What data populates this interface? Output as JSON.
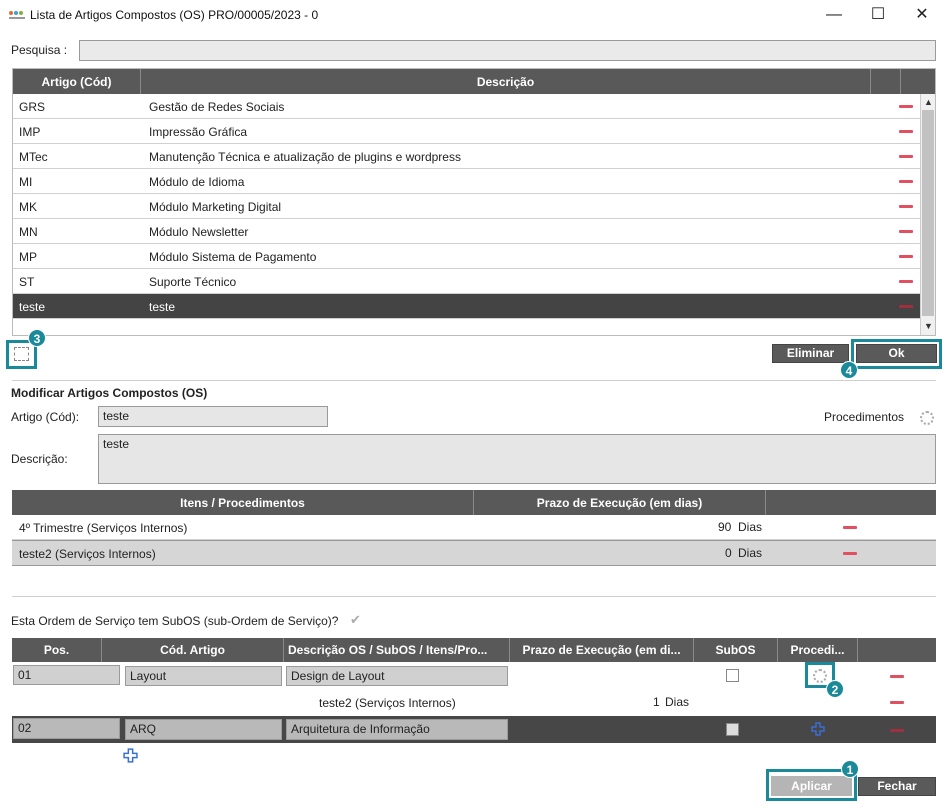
{
  "window": {
    "title": "Lista de Artigos Compostos (OS) PRO/00005/2023 - 0",
    "minimize": "—",
    "maximize": "☐",
    "close": "✕"
  },
  "search": {
    "label": "Pesquisa :",
    "value": ""
  },
  "articles_table": {
    "headers": [
      "Artigo (Cód)",
      "Descrição"
    ],
    "rows": [
      {
        "code": "GRS",
        "desc": "Gestão de Redes Sociais"
      },
      {
        "code": "IMP",
        "desc": "Impressão Gráfica"
      },
      {
        "code": "MTec",
        "desc": "Manutenção Técnica e atualização de plugins e wordpress"
      },
      {
        "code": "MI",
        "desc": "Módulo de Idioma"
      },
      {
        "code": "MK",
        "desc": "Módulo Marketing Digital"
      },
      {
        "code": "MN",
        "desc": "Módulo Newsletter"
      },
      {
        "code": "MP",
        "desc": "Módulo Sistema de Pagamento"
      },
      {
        "code": "ST",
        "desc": "Suporte Técnico"
      },
      {
        "code": "teste",
        "desc": "teste"
      }
    ],
    "selected_index": 8
  },
  "buttons": {
    "eliminar": "Eliminar",
    "ok": "Ok",
    "aplicar": "Aplicar",
    "fechar": "Fechar"
  },
  "callouts": [
    "1",
    "2",
    "3",
    "4"
  ],
  "modify": {
    "section_title": "Modificar Artigos Compostos (OS)",
    "code_label": "Artigo (Cód):",
    "code_value": "teste",
    "desc_label": "Descrição:",
    "desc_value": "teste",
    "procedimentos_label": "Procedimentos"
  },
  "items_table": {
    "headers": [
      "Itens / Procedimentos",
      "Prazo de Execução (em dias)"
    ],
    "rows": [
      {
        "item": "4º Trimestre (Serviços Internos)",
        "days": "90",
        "unit": "Dias"
      },
      {
        "item": "teste2 (Serviços Internos)",
        "days": "0",
        "unit": "Dias"
      }
    ]
  },
  "subos": {
    "question": "Esta Ordem de Serviço tem SubOS (sub-Ordem de Serviço)?",
    "checked": true,
    "headers": [
      "Pos.",
      "Cód. Artigo",
      "Descrição OS / SubOS / Itens/Pro...",
      "Prazo de Execução (em di...",
      "SubOS",
      "Procedi..."
    ],
    "rows": [
      {
        "pos": "01",
        "code": "Layout",
        "desc": "Design de Layout"
      },
      {
        "pos": "02",
        "code": "ARQ",
        "desc": "Arquitetura de Informação"
      }
    ],
    "sub_row": {
      "item": "teste2 (Serviços Internos)",
      "days": "1",
      "unit": "Dias"
    }
  },
  "colors": {
    "accent": "#1a8a9a",
    "header": "#595959",
    "remove": "#e05060",
    "add": "#3a6fd8"
  }
}
